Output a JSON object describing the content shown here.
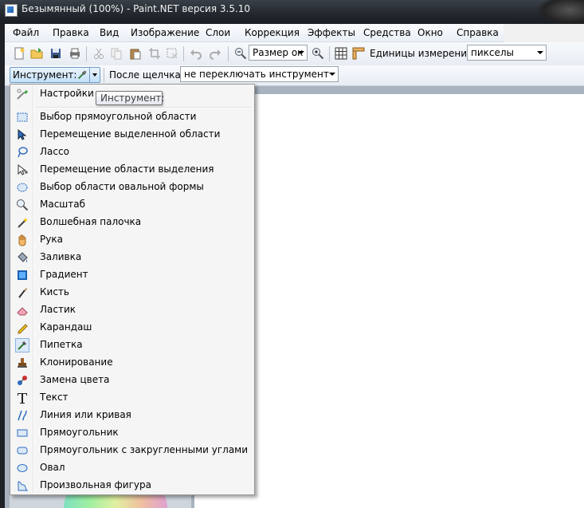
{
  "window": {
    "title": "Безымянный (100%) - Paint.NET версия 3.5.10"
  },
  "menubar": {
    "items": [
      "Файл",
      "Правка",
      "Вид",
      "Изображение",
      "Слои",
      "Коррекция",
      "Эффекты",
      "Средства",
      "Окно",
      "Справка"
    ]
  },
  "toolbar": {
    "zoom_combo": "Размер ок",
    "units_label": "Единицы измерения:",
    "units_value": "пикселы",
    "icons": [
      "new-icon",
      "open-icon",
      "save-icon",
      "print-icon",
      "cut-icon",
      "copy-icon",
      "paste-icon",
      "crop-icon",
      "deselect-icon",
      "undo-icon",
      "redo-icon",
      "zoom-out-icon",
      "zoom-in-icon",
      "grid-icon",
      "ruler-icon"
    ]
  },
  "toolbar2": {
    "tool_label": "Инструмент:",
    "after_click_label": "После щелчка:",
    "after_click_value": "не переключать инструмент"
  },
  "tooltip": {
    "text": "Инструмент:"
  },
  "tool_menu": {
    "settings": "Настройки п",
    "items": [
      {
        "label": "Выбор прямоугольной области",
        "icon": "rect-select-icon"
      },
      {
        "label": "Перемещение выделенной области",
        "icon": "move-selected-icon"
      },
      {
        "label": "Лассо",
        "icon": "lasso-icon"
      },
      {
        "label": "Перемещение области выделения",
        "icon": "move-selection-icon"
      },
      {
        "label": "Выбор области овальной формы",
        "icon": "ellipse-select-icon"
      },
      {
        "label": "Масштаб",
        "icon": "zoom-icon"
      },
      {
        "label": "Волшебная палочка",
        "icon": "magic-wand-icon"
      },
      {
        "label": "Рука",
        "icon": "hand-icon"
      },
      {
        "label": "Заливка",
        "icon": "bucket-icon"
      },
      {
        "label": "Градиент",
        "icon": "gradient-icon"
      },
      {
        "label": "Кисть",
        "icon": "brush-icon"
      },
      {
        "label": "Ластик",
        "icon": "eraser-icon"
      },
      {
        "label": "Карандаш",
        "icon": "pencil-icon"
      },
      {
        "label": "Пипетка",
        "icon": "pipette-icon",
        "checked": true
      },
      {
        "label": "Клонирование",
        "icon": "clone-stamp-icon"
      },
      {
        "label": "Замена цвета",
        "icon": "recolor-icon"
      },
      {
        "label": "Текст",
        "icon": "text-icon"
      },
      {
        "label": "Линия или кривая",
        "icon": "line-curve-icon"
      },
      {
        "label": "Прямоугольник",
        "icon": "rectangle-icon"
      },
      {
        "label": "Прямоугольник с закругленными углами",
        "icon": "rounded-rect-icon"
      },
      {
        "label": "Овал",
        "icon": "ellipse-icon"
      },
      {
        "label": "Произвольная фигура",
        "icon": "freeform-shape-icon"
      }
    ]
  },
  "colors": {
    "menu_bg": "#f5f5f5",
    "accent": "#6e9ccc",
    "canvas": "#ffffff"
  }
}
